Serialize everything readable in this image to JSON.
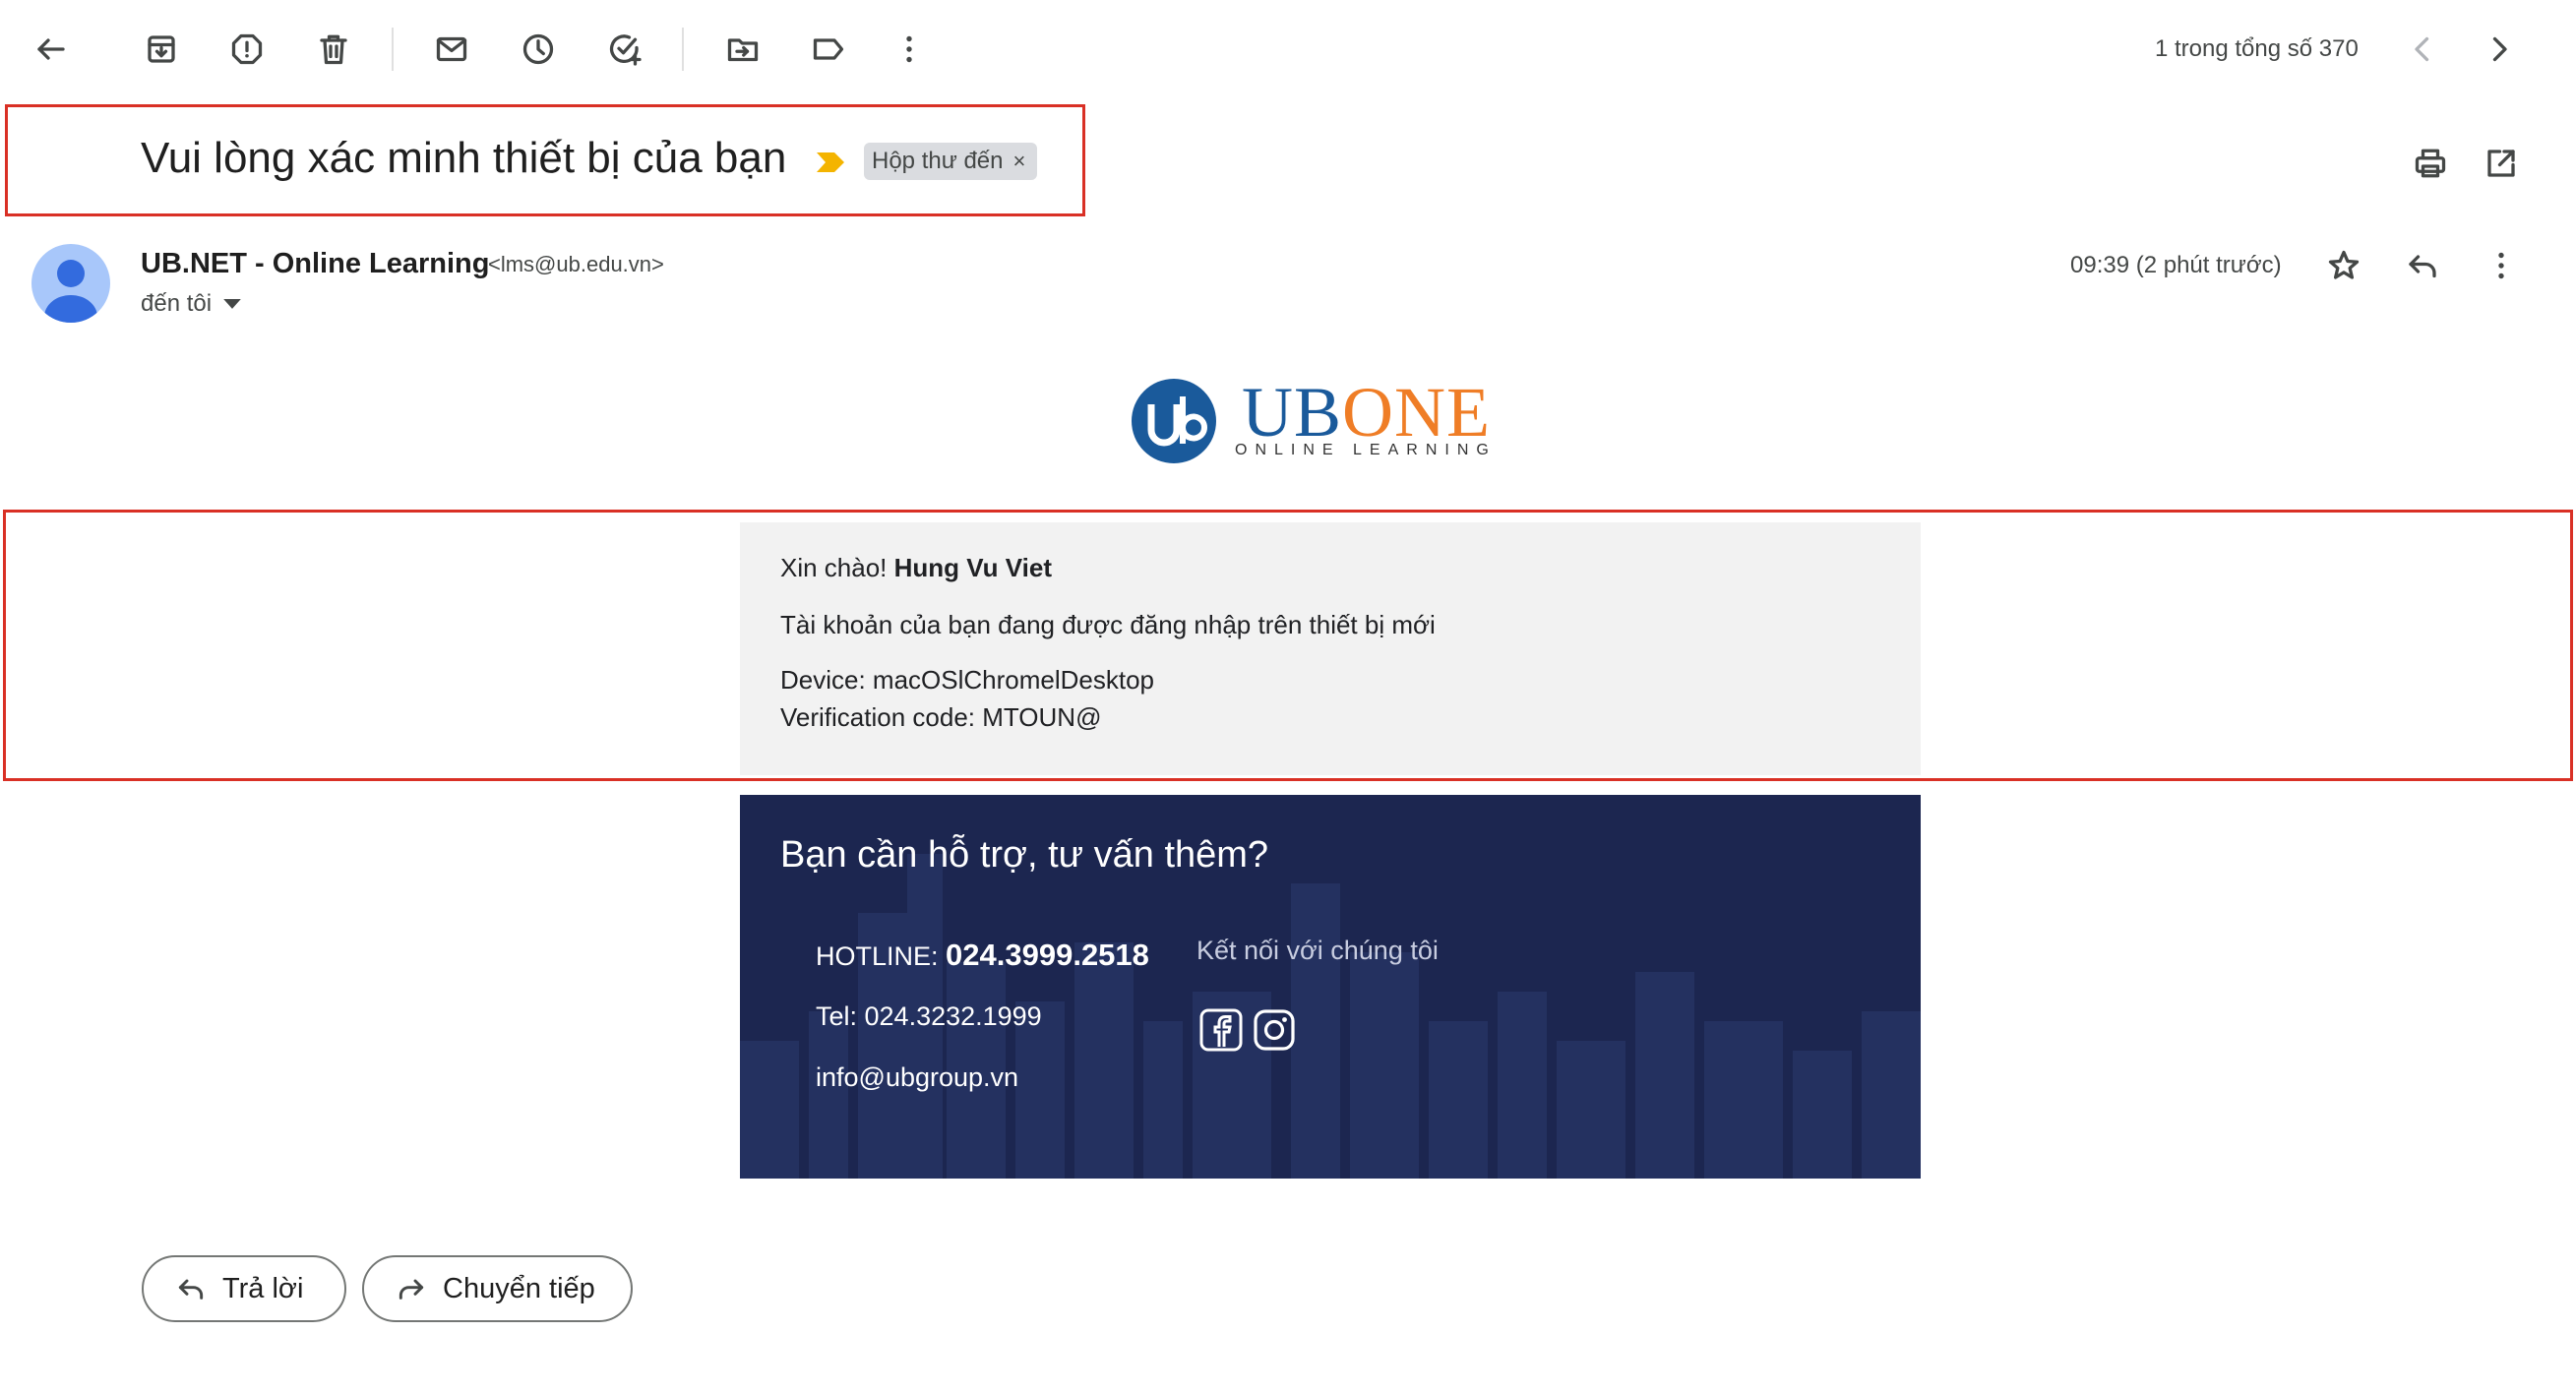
{
  "toolbar": {
    "icons": [
      "back-arrow-icon",
      "archive-icon",
      "report-spam-icon",
      "delete-icon",
      "mark-unread-icon",
      "snooze-icon",
      "add-task-icon",
      "move-to-icon",
      "label-icon",
      "more-vert-icon"
    ],
    "pager_text": "1 trong tổng số 370"
  },
  "email": {
    "subject": "Vui lòng xác minh thiết bị của bạn",
    "label": "Hộp thư đến",
    "label_remove": "×",
    "sender_name": "UB.NET - Online Learning",
    "sender_email": "<lms@ub.edu.vn>",
    "to": "đến tôi",
    "time": "09:39 (2 phút trước)"
  },
  "logo": {
    "mark": "ub",
    "name_part1": "UB",
    "name_part2": "ONE",
    "tagline": "ONLINE LEARNING"
  },
  "message": {
    "greeting_prefix": "Xin chào! ",
    "greeting_name": "Hung Vu Viet",
    "line1": "Tài khoản của bạn đang được đăng nhập trên thiết bị mới",
    "device_line": "Device: macOSlChromelDesktop",
    "code_line": "Verification code: MTOUN@"
  },
  "footer": {
    "title": "Bạn cần hỗ trợ, tư vấn thêm?",
    "hotline_label": "HOTLINE: ",
    "hotline_number": "024.3999.2518",
    "tel": "Tel: 024.3232.1999",
    "email": "info@ubgroup.vn",
    "connect_label": "Kết nối với chúng tôi",
    "socials": [
      "facebook-icon",
      "instagram-icon"
    ]
  },
  "actions": {
    "reply": "Trả lời",
    "forward": "Chuyển tiếp"
  },
  "colors": {
    "highlight": "#d93025",
    "footer_bg": "#1c2650",
    "brand_blue": "#1a5a9b",
    "brand_orange": "#ef7d26",
    "label_important": "#f4b400"
  }
}
